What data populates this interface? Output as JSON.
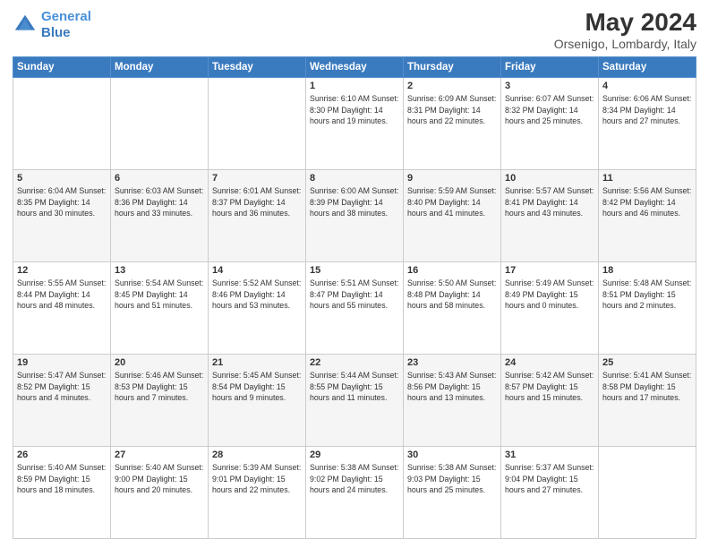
{
  "header": {
    "logo_line1": "General",
    "logo_line2": "Blue",
    "month": "May 2024",
    "location": "Orsenigo, Lombardy, Italy"
  },
  "days_of_week": [
    "Sunday",
    "Monday",
    "Tuesday",
    "Wednesday",
    "Thursday",
    "Friday",
    "Saturday"
  ],
  "weeks": [
    [
      {
        "day": "",
        "info": ""
      },
      {
        "day": "",
        "info": ""
      },
      {
        "day": "",
        "info": ""
      },
      {
        "day": "1",
        "info": "Sunrise: 6:10 AM\nSunset: 8:30 PM\nDaylight: 14 hours\nand 19 minutes."
      },
      {
        "day": "2",
        "info": "Sunrise: 6:09 AM\nSunset: 8:31 PM\nDaylight: 14 hours\nand 22 minutes."
      },
      {
        "day": "3",
        "info": "Sunrise: 6:07 AM\nSunset: 8:32 PM\nDaylight: 14 hours\nand 25 minutes."
      },
      {
        "day": "4",
        "info": "Sunrise: 6:06 AM\nSunset: 8:34 PM\nDaylight: 14 hours\nand 27 minutes."
      }
    ],
    [
      {
        "day": "5",
        "info": "Sunrise: 6:04 AM\nSunset: 8:35 PM\nDaylight: 14 hours\nand 30 minutes."
      },
      {
        "day": "6",
        "info": "Sunrise: 6:03 AM\nSunset: 8:36 PM\nDaylight: 14 hours\nand 33 minutes."
      },
      {
        "day": "7",
        "info": "Sunrise: 6:01 AM\nSunset: 8:37 PM\nDaylight: 14 hours\nand 36 minutes."
      },
      {
        "day": "8",
        "info": "Sunrise: 6:00 AM\nSunset: 8:39 PM\nDaylight: 14 hours\nand 38 minutes."
      },
      {
        "day": "9",
        "info": "Sunrise: 5:59 AM\nSunset: 8:40 PM\nDaylight: 14 hours\nand 41 minutes."
      },
      {
        "day": "10",
        "info": "Sunrise: 5:57 AM\nSunset: 8:41 PM\nDaylight: 14 hours\nand 43 minutes."
      },
      {
        "day": "11",
        "info": "Sunrise: 5:56 AM\nSunset: 8:42 PM\nDaylight: 14 hours\nand 46 minutes."
      }
    ],
    [
      {
        "day": "12",
        "info": "Sunrise: 5:55 AM\nSunset: 8:44 PM\nDaylight: 14 hours\nand 48 minutes."
      },
      {
        "day": "13",
        "info": "Sunrise: 5:54 AM\nSunset: 8:45 PM\nDaylight: 14 hours\nand 51 minutes."
      },
      {
        "day": "14",
        "info": "Sunrise: 5:52 AM\nSunset: 8:46 PM\nDaylight: 14 hours\nand 53 minutes."
      },
      {
        "day": "15",
        "info": "Sunrise: 5:51 AM\nSunset: 8:47 PM\nDaylight: 14 hours\nand 55 minutes."
      },
      {
        "day": "16",
        "info": "Sunrise: 5:50 AM\nSunset: 8:48 PM\nDaylight: 14 hours\nand 58 minutes."
      },
      {
        "day": "17",
        "info": "Sunrise: 5:49 AM\nSunset: 8:49 PM\nDaylight: 15 hours\nand 0 minutes."
      },
      {
        "day": "18",
        "info": "Sunrise: 5:48 AM\nSunset: 8:51 PM\nDaylight: 15 hours\nand 2 minutes."
      }
    ],
    [
      {
        "day": "19",
        "info": "Sunrise: 5:47 AM\nSunset: 8:52 PM\nDaylight: 15 hours\nand 4 minutes."
      },
      {
        "day": "20",
        "info": "Sunrise: 5:46 AM\nSunset: 8:53 PM\nDaylight: 15 hours\nand 7 minutes."
      },
      {
        "day": "21",
        "info": "Sunrise: 5:45 AM\nSunset: 8:54 PM\nDaylight: 15 hours\nand 9 minutes."
      },
      {
        "day": "22",
        "info": "Sunrise: 5:44 AM\nSunset: 8:55 PM\nDaylight: 15 hours\nand 11 minutes."
      },
      {
        "day": "23",
        "info": "Sunrise: 5:43 AM\nSunset: 8:56 PM\nDaylight: 15 hours\nand 13 minutes."
      },
      {
        "day": "24",
        "info": "Sunrise: 5:42 AM\nSunset: 8:57 PM\nDaylight: 15 hours\nand 15 minutes."
      },
      {
        "day": "25",
        "info": "Sunrise: 5:41 AM\nSunset: 8:58 PM\nDaylight: 15 hours\nand 17 minutes."
      }
    ],
    [
      {
        "day": "26",
        "info": "Sunrise: 5:40 AM\nSunset: 8:59 PM\nDaylight: 15 hours\nand 18 minutes."
      },
      {
        "day": "27",
        "info": "Sunrise: 5:40 AM\nSunset: 9:00 PM\nDaylight: 15 hours\nand 20 minutes."
      },
      {
        "day": "28",
        "info": "Sunrise: 5:39 AM\nSunset: 9:01 PM\nDaylight: 15 hours\nand 22 minutes."
      },
      {
        "day": "29",
        "info": "Sunrise: 5:38 AM\nSunset: 9:02 PM\nDaylight: 15 hours\nand 24 minutes."
      },
      {
        "day": "30",
        "info": "Sunrise: 5:38 AM\nSunset: 9:03 PM\nDaylight: 15 hours\nand 25 minutes."
      },
      {
        "day": "31",
        "info": "Sunrise: 5:37 AM\nSunset: 9:04 PM\nDaylight: 15 hours\nand 27 minutes."
      },
      {
        "day": "",
        "info": ""
      }
    ]
  ]
}
